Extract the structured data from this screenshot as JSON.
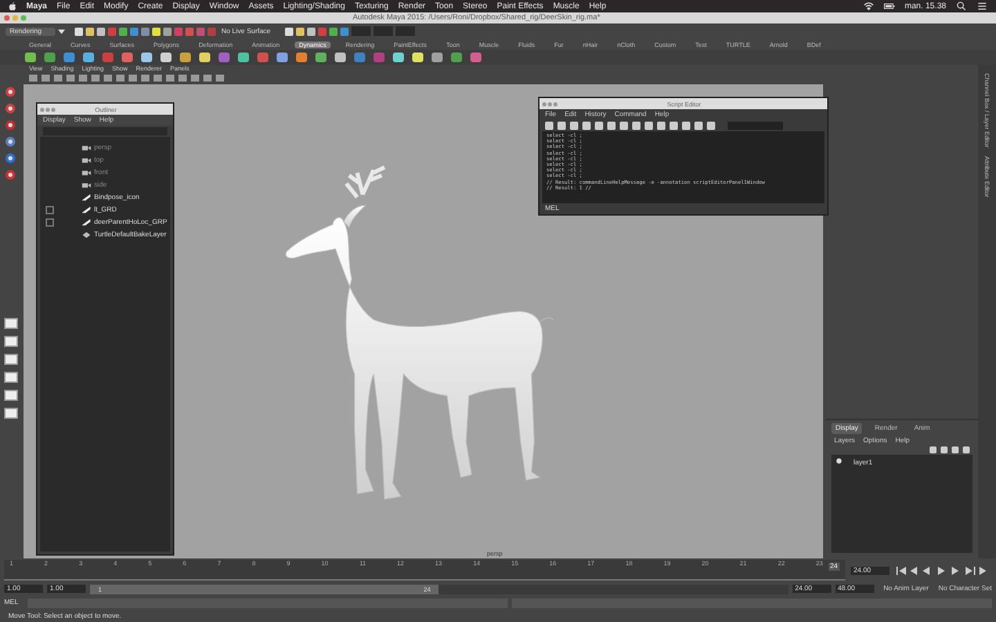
{
  "menu_bar": {
    "app": "Maya",
    "items": [
      "File",
      "Edit",
      "Modify",
      "Create",
      "Display",
      "Window",
      "Assets",
      "Lighting/Shading",
      "Texturing",
      "Render",
      "Toon",
      "Stereo",
      "Paint Effects",
      "Muscle",
      "Help"
    ],
    "clock": "man. 15.38"
  },
  "window": {
    "title": "Autodesk Maya 2015: /Users/Roni/Dropbox/Shared_rig/DeerSkin_rig.ma*"
  },
  "status_line": {
    "menu_set": "Rendering",
    "live_surface": "No Live Surface"
  },
  "shelf": {
    "tabs": [
      {
        "label": "General",
        "selected": false
      },
      {
        "label": "Curves",
        "selected": false
      },
      {
        "label": "Surfaces",
        "selected": false
      },
      {
        "label": "Polygons",
        "selected": false
      },
      {
        "label": "Deformation",
        "selected": false
      },
      {
        "label": "Animation",
        "selected": false
      },
      {
        "label": "Dynamics",
        "selected": true
      },
      {
        "label": "Rendering",
        "selected": false
      },
      {
        "label": "PaintEffects",
        "selected": false
      },
      {
        "label": "Toon",
        "selected": false
      },
      {
        "label": "Muscle",
        "selected": false
      },
      {
        "label": "Fluids",
        "selected": false
      },
      {
        "label": "Fur",
        "selected": false
      },
      {
        "label": "nHair",
        "selected": false
      },
      {
        "label": "nCloth",
        "selected": false
      },
      {
        "label": "Custom",
        "selected": false
      },
      {
        "label": "Test",
        "selected": false
      },
      {
        "label": "TURTLE",
        "selected": false
      },
      {
        "label": "Arnold",
        "selected": false
      },
      {
        "label": "BDef",
        "selected": false
      }
    ]
  },
  "viewport": {
    "menus": [
      "View",
      "Shading",
      "Lighting",
      "Show",
      "Renderer",
      "Panels"
    ],
    "camera_label": "persp"
  },
  "outliner": {
    "title": "Outliner",
    "menus": [
      "Display",
      "Show",
      "Help"
    ],
    "items": [
      {
        "label": "persp",
        "kind": "camera",
        "expandable": false
      },
      {
        "label": "top",
        "kind": "camera",
        "expandable": false
      },
      {
        "label": "front",
        "kind": "camera",
        "expandable": false
      },
      {
        "label": "side",
        "kind": "camera",
        "expandable": false
      },
      {
        "label": "Bindpose_icon",
        "kind": "set",
        "expandable": false
      },
      {
        "label": "lt_GRD",
        "kind": "set",
        "expandable": true
      },
      {
        "label": "deerParentHoLoc_GRP",
        "kind": "set",
        "expandable": true
      },
      {
        "label": "TurtleDefaultBakeLayer",
        "kind": "layer",
        "expandable": false
      }
    ]
  },
  "script_editor": {
    "title": "Script Editor",
    "menus": [
      "File",
      "Edit",
      "History",
      "Command",
      "Help"
    ],
    "output": [
      "select -cl ;",
      "select -cl ;",
      "select -cl ;",
      "select -cl ;",
      "select -cl ;",
      "select -cl ;",
      "select -cl ;",
      "select -cl ;",
      "// Result: commandLineHelpMessage -e -annotation scriptEditorPanel1Window",
      "// Result: 1 //"
    ],
    "input_label": "MEL"
  },
  "layer_editor": {
    "tabs": [
      {
        "label": "Display",
        "selected": true
      },
      {
        "label": "Render",
        "selected": false
      },
      {
        "label": "Anim",
        "selected": false
      }
    ],
    "menus": [
      "Layers",
      "Options",
      "Help"
    ],
    "layers": [
      {
        "name": "layer1",
        "visible": true
      }
    ]
  },
  "side_tabs": [
    "Channel Box / Layer Editor",
    "Attribute Editor"
  ],
  "timeline": {
    "ticks": [
      "1",
      "2",
      "3",
      "4",
      "5",
      "6",
      "7",
      "8",
      "9",
      "10",
      "11",
      "12",
      "13",
      "14",
      "15",
      "16",
      "17",
      "18",
      "19",
      "20",
      "21",
      "22",
      "23"
    ],
    "current_frame": "24",
    "level": 1,
    "current_time": "24.00"
  },
  "range_slider": {
    "start": "1.00",
    "range_start": "1.00",
    "range_start_handle": "1",
    "range_end_handle": "24",
    "level": 0.5,
    "range_end": "24.00",
    "end": "48.00",
    "anim_layer": "No Anim Layer",
    "character_set": "No Character Set"
  },
  "command_line": {
    "language": "MEL"
  },
  "help_line": "Move Tool: Select an object to move."
}
